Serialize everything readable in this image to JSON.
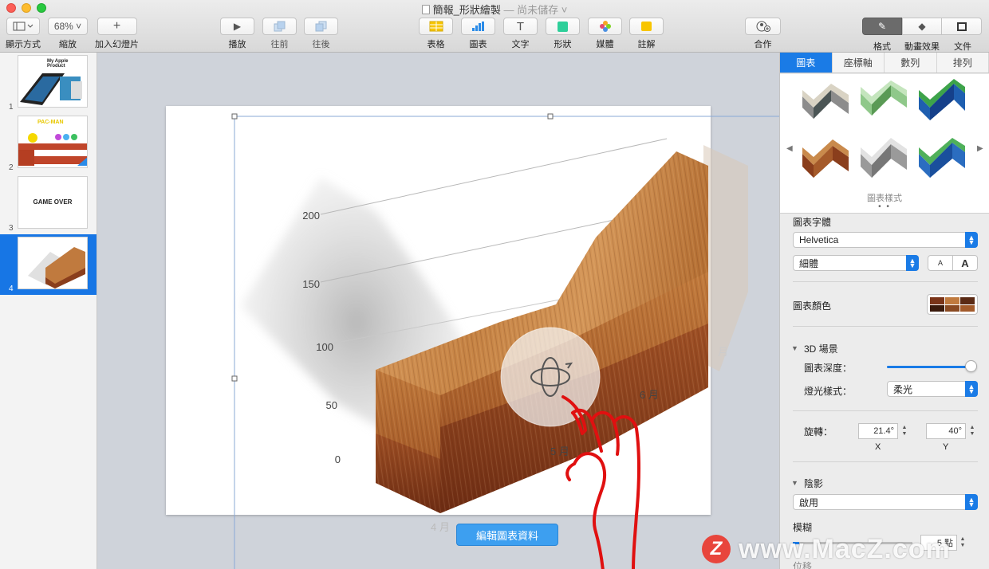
{
  "window": {
    "title": "簡報_形狀繪製",
    "separator": "—",
    "save_state": "尚未儲存"
  },
  "toolbar": {
    "view_label": "顯示方式",
    "zoom_value": "68%",
    "zoom_label": "縮放",
    "add_slide_label": "加入幻燈片",
    "play_label": "播放",
    "forward_label": "往前",
    "backward_label": "往後",
    "table_label": "表格",
    "chart_label": "圖表",
    "text_label": "文字",
    "shape_label": "形狀",
    "media_label": "媒體",
    "comment_label": "註解",
    "collaborate_label": "合作",
    "format_label": "格式",
    "animate_label": "動畫效果",
    "document_label": "文件"
  },
  "navigator": {
    "slides": [
      {
        "number": "1",
        "caption": "My Apple Product"
      },
      {
        "number": "2",
        "caption": "PAC-MAN"
      },
      {
        "number": "3",
        "caption": "GAME OVER"
      },
      {
        "number": "4",
        "caption": ""
      }
    ],
    "selected": 4
  },
  "canvas": {
    "edit_chart_data": "編輯圖表資料"
  },
  "chart_data": {
    "type": "area",
    "style": "3D wood",
    "categories": [
      "4 月",
      "5 月",
      "6 月",
      "月"
    ],
    "y_ticks": [
      "0",
      "50",
      "100",
      "150",
      "200"
    ],
    "ylim": [
      0,
      200
    ],
    "series": [
      {
        "values": [
          60,
          95,
          150,
          190
        ]
      }
    ],
    "rotation_x": "21.4°",
    "rotation_y": "40°"
  },
  "inspector": {
    "tabs": [
      "圖表",
      "座標軸",
      "數列",
      "排列"
    ],
    "active_tab": "圖表",
    "style_caption": "圖表樣式",
    "page_dots": "• •",
    "chart_font_label": "圖表字體",
    "font_family": "Helvetica",
    "font_weight": "細體",
    "font_smaller": "A",
    "font_larger": "A",
    "chart_colors_label": "圖表顏色",
    "scene_3d_label": "3D 場景",
    "chart_depth_label": "圖表深度：",
    "chart_depth_value": 0.95,
    "lighting_label": "燈光樣式：",
    "lighting_value": "柔光",
    "rotation_label": "旋轉：",
    "rotation_x": "21.4°",
    "rotation_y": "40°",
    "x_caption": "X",
    "y_caption": "Y",
    "shadow_label": "陰影",
    "shadow_value": "啟用",
    "blur_label": "模糊",
    "blur_value": "5 點",
    "offset_label": "位移"
  },
  "watermark": {
    "logo": "Z",
    "text": "www.MacZ.com"
  },
  "colors": {
    "accent": "#1a7be6",
    "wood_light": "#c9894d",
    "wood_dark": "#8a4020"
  }
}
